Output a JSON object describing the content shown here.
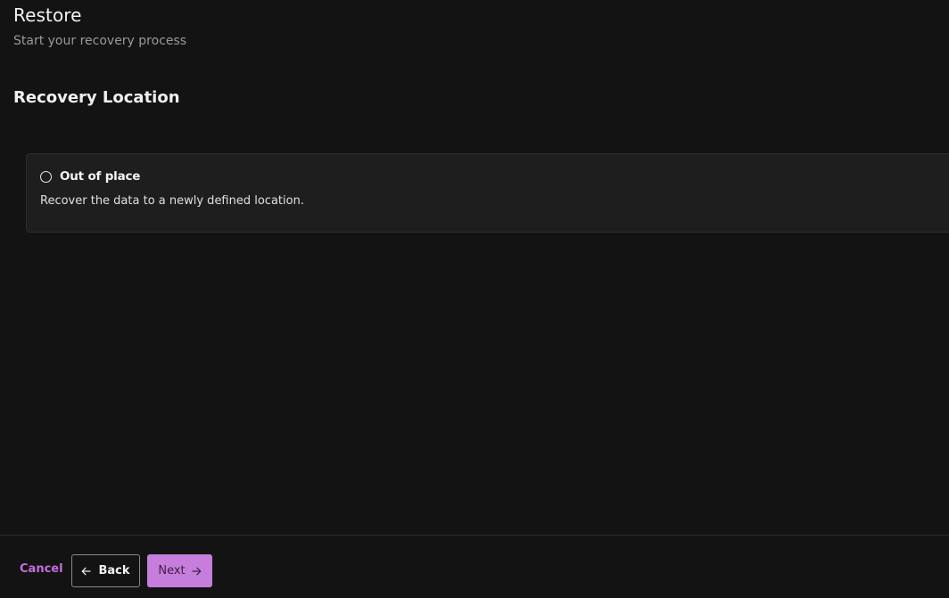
{
  "header": {
    "title": "Restore",
    "subtitle": "Start your recovery process"
  },
  "section": {
    "title": "Recovery Location"
  },
  "options": [
    {
      "label": "Out of place",
      "description": "Recover the data to a newly defined location.",
      "selected": false
    }
  ],
  "footer": {
    "cancel_label": "Cancel",
    "back_label": "Back",
    "next_label": "Next"
  },
  "colors": {
    "background": "#131314",
    "card": "#1e1e1f",
    "accent": "#c77ddb",
    "cancel_text": "#c36fd9"
  },
  "icons": {
    "back": "arrow-left-icon",
    "next": "arrow-right-icon",
    "radio": "radio-unchecked-icon"
  }
}
